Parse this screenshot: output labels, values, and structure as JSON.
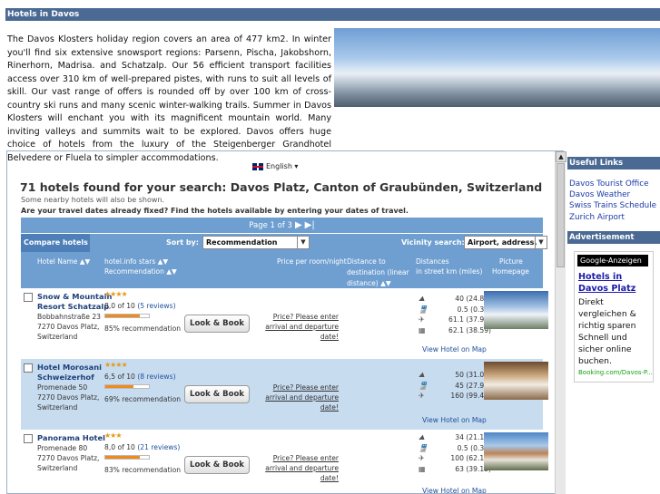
{
  "page": {
    "title": "Hotels in Davos"
  },
  "intro": {
    "text": "The Davos Klosters holiday region covers an area of 477 km2. In winter you'll find six extensive snowsport regions: Parsenn, Pischa, Jakobshorn, Rinerhorn, Madrisa. and Schatzalp. Our 56 efficient transport facilities access over 310 km of well-prepared pistes, with runs to suit all levels of skill. Our vast range of offers is rounded off by over 100 km of cross-country ski runs and many scenic winter-walking trails. Summer in Davos Klosters will enchant you with its magnificent mountain world. Many inviting valleys and summits wait to be explored. Davos offers huge choice of hotels from the luxury of the Steigenberger Grandhotel Belvedere or Fluela to simpler accommodations."
  },
  "language": {
    "label": "English"
  },
  "search": {
    "headline": "71 hotels found for your search: Davos Platz, Canton of Graubünden, Switzerland",
    "nearby_note": "Some nearby hotels will also be shown.",
    "dates_prompt": "Are your travel dates already fixed? Find the hotels available by entering your dates of travel.",
    "page_label": "Page 1 of 3",
    "compare_label": "Compare hotels",
    "sort_label": "Sort by:",
    "sort_value": "Recommendation",
    "vicinity_label": "Vicinity search:",
    "vicinity_value": "Airport, address, ..."
  },
  "columns": {
    "name": "Hotel Name ▲▼",
    "stars": "hotel.info stars ▲▼",
    "recommendation": "Recommendation ▲▼",
    "price": "Price per room/night",
    "distance": "Distance to destination (linear distance) ▲▼",
    "distances": "Distances",
    "distances_sub": "in street km (miles)",
    "picture": "Picture",
    "homepage": "Homepage"
  },
  "hotels": [
    {
      "name": "Snow & Mountain Resort Schatzalp",
      "stars": "★★★★",
      "address": [
        "Bobbahnstraße 23",
        "7270 Davos Platz,",
        "Switzerland"
      ],
      "rating_text": "8,0 of 10",
      "reviews": "(5 reviews)",
      "rating_fill": 0.8,
      "recommendation": "85% recommendation",
      "button": "Look & Book",
      "price_line1": "Price? Please enter",
      "price_line2": "arrival and departure date!",
      "distances": [
        "40 (24.85)",
        "0.5 (0.31)",
        "61.1 (37.97)",
        "62.1 (38.59)"
      ],
      "map_link": "View Hotel on Map"
    },
    {
      "name": "Hotel Morosani Schweizerhof",
      "stars": "★★★★",
      "address": [
        "Promenade 50",
        "7270 Davos Platz,",
        "Switzerland"
      ],
      "rating_text": "6,5 of 10",
      "reviews": "(8 reviews)",
      "rating_fill": 0.65,
      "recommendation": "69% recommendation",
      "button": "Look & Book",
      "price_line1": "Price? Please enter",
      "price_line2": "arrival and departure date!",
      "distances": [
        "50 (31.07)",
        "45 (27.96)",
        "160 (99.42)"
      ],
      "map_link": "View Hotel on Map"
    },
    {
      "name": "Panorama Hotel",
      "stars": "★★★",
      "address": [
        "Promenade 80",
        "7270 Davos Platz,",
        "Switzerland"
      ],
      "rating_text": "8,0 of 10",
      "reviews": "(21 reviews)",
      "rating_fill": 0.8,
      "recommendation": "83% recommendation",
      "button": "Look & Book",
      "price_line1": "Price? Please enter",
      "price_line2": "arrival and departure date!",
      "distances": [
        "34 (21.13)",
        "0.5 (0.31)",
        "100 (62.14)",
        "63 (39.15)"
      ],
      "map_link": "View Hotel on Map"
    }
  ],
  "sidebar": {
    "useful_heading": "Useful Links",
    "links": [
      "Davos Tourist Office",
      "Davos Weather",
      "Swiss Trains Schedule",
      "Zurich Airport"
    ],
    "ad_heading": "Advertisement",
    "ad": {
      "logo": "Google-Anzeigen",
      "title": "Hotels in Davos Platz",
      "text": "Direkt vergleichen & richtig sparen Schnell und sicher online buchen.",
      "url": "Booking.com/Davos-P..."
    }
  }
}
